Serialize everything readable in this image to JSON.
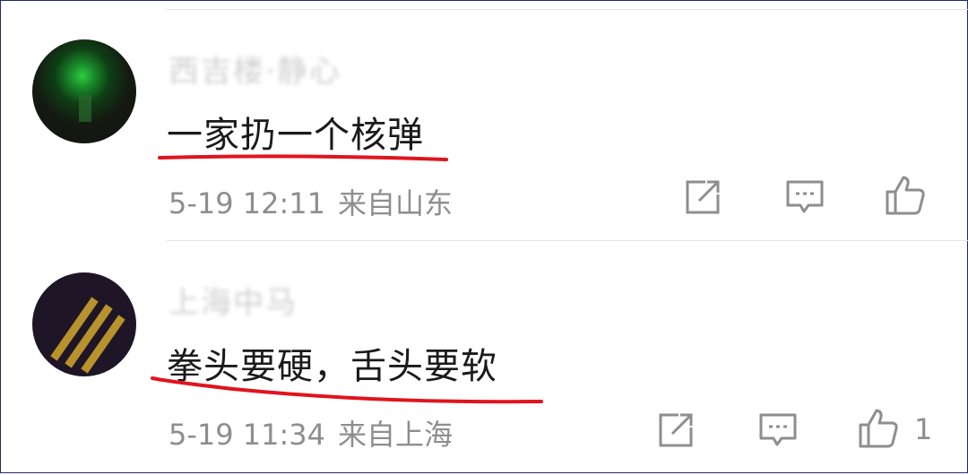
{
  "comments": [
    {
      "username": "西吉楼·静心",
      "text": "一家扔一个核弹",
      "time": "5-19 12:11",
      "location": "来自山东",
      "like_count": "",
      "avatar": "green-glow-avatar"
    },
    {
      "username": "上海中马",
      "text": "拳头要硬，舌头要软",
      "time": "5-19 11:34",
      "location": "来自上海",
      "like_count": "1",
      "avatar": "gold-stripes-avatar"
    }
  ],
  "icons": {
    "share": "share-icon",
    "reply": "comment-icon",
    "like": "thumbs-up-icon"
  },
  "colors": {
    "underline": "#e0141e",
    "meta_text": "#8e8e8e",
    "icon": "#8e8e8e"
  }
}
